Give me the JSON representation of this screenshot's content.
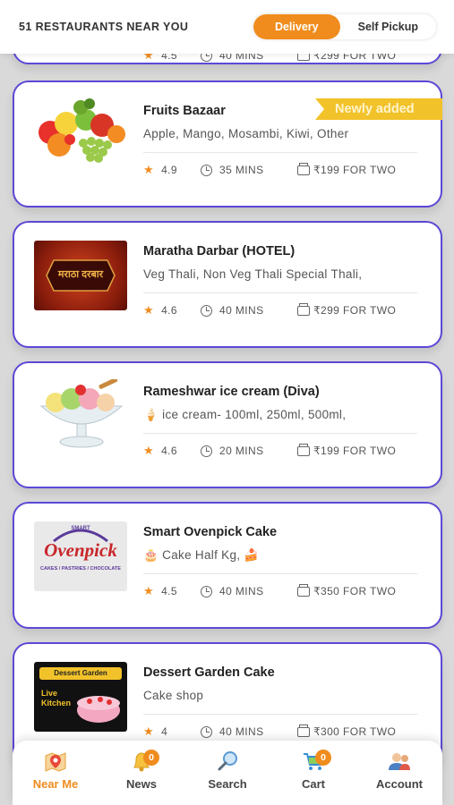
{
  "header": {
    "restaurant_count": "51 RESTAURANTS NEAR YOU",
    "delivery_label": "Delivery",
    "pickup_label": "Self Pickup",
    "active_mode": "Delivery"
  },
  "partial_card": {
    "rating": "4.5",
    "time": "40 MINS",
    "cost": "₹299 FOR TWO"
  },
  "restaurants": [
    {
      "name": "Fruits Bazaar",
      "desc": "Apple, Mango, Mosambi, Kiwi, Other",
      "rating": "4.9",
      "time": "35 MINS",
      "cost": "₹199 FOR TWO",
      "ribbon": "Newly added",
      "image": "fruits-image"
    },
    {
      "name": "Maratha Darbar (HOTEL)",
      "desc": "Veg Thali, Non Veg Thali Special Thali,",
      "rating": "4.6",
      "time": "40 MINS",
      "cost": "₹299 FOR TWO",
      "image": "maratha-darbar-logo",
      "logo_text": "मराठा दरबार"
    },
    {
      "name": "Rameshwar ice cream (Diva)",
      "desc": "🍦 ice cream- 100ml, 250ml, 500ml,",
      "rating": "4.6",
      "time": "20 MINS",
      "cost": "₹199 FOR TWO",
      "image": "ice-cream-image"
    },
    {
      "name": "Smart Ovenpick Cake",
      "desc": "🎂 Cake Half Kg, 🍰",
      "rating": "4.5",
      "time": "40 MINS",
      "cost": "₹350 FOR TWO",
      "image": "ovenpick-logo",
      "logo_text": "Ovenpick",
      "logo_top": "SMART",
      "logo_sub": "CAKES / PASTRIES / CHOCOLATE"
    },
    {
      "name": "Dessert Garden Cake",
      "desc": "Cake shop",
      "rating": "4",
      "time": "40 MINS",
      "cost": "₹300 FOR TWO",
      "image": "dessert-garden-logo",
      "logo_text": "Dessert Garden",
      "logo_sub1": "Live",
      "logo_sub2": "Kitchen"
    }
  ],
  "nav": [
    {
      "label": "Near Me",
      "icon": "map-pin-icon",
      "active": true
    },
    {
      "label": "News",
      "icon": "bell-icon",
      "badge": "0"
    },
    {
      "label": "Search",
      "icon": "search-icon"
    },
    {
      "label": "Cart",
      "icon": "cart-icon",
      "badge": "0"
    },
    {
      "label": "Account",
      "icon": "account-icon"
    }
  ],
  "colors": {
    "accent": "#f08c1e",
    "card_border": "#5b48d6",
    "ribbon": "#f2c22a"
  }
}
